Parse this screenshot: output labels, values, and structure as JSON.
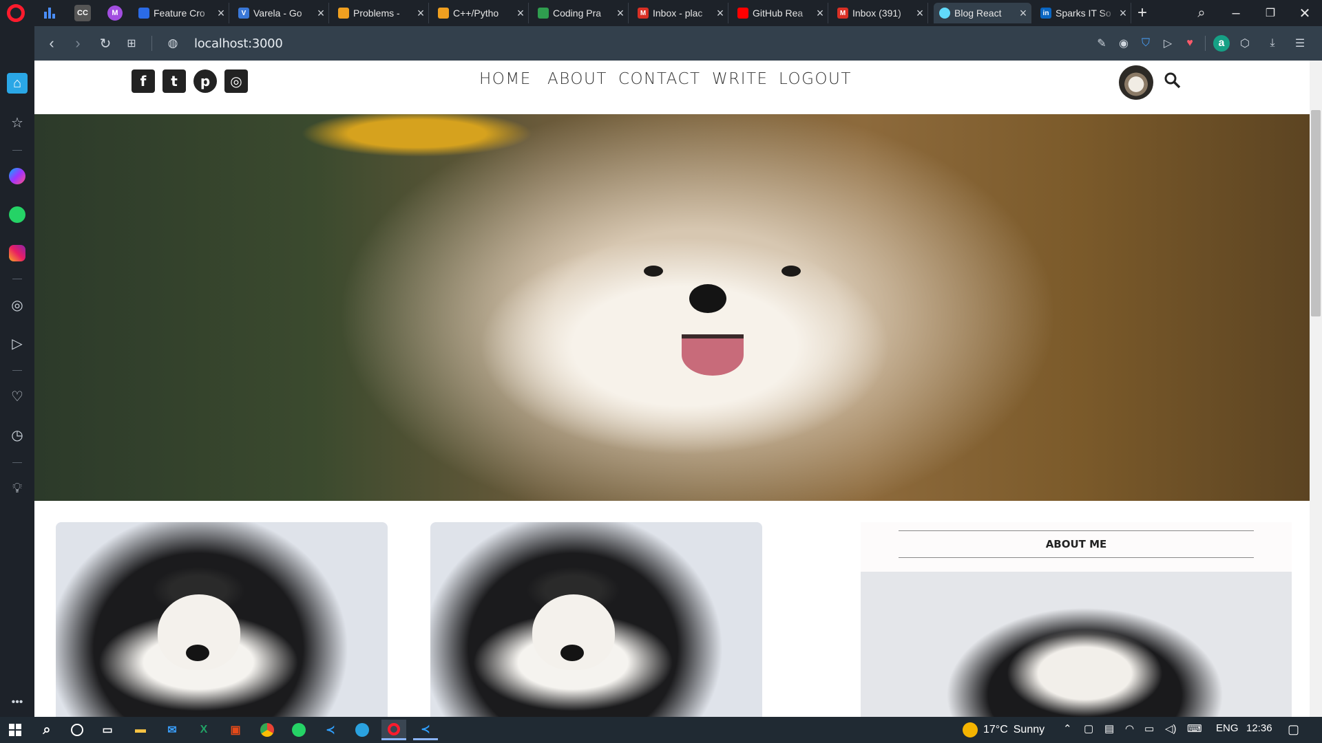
{
  "browser": {
    "tabs": [
      {
        "title": "Feature Cro",
        "favicon_color": "#2b6be6",
        "favicon_text": ""
      },
      {
        "title": "Varela - Go",
        "favicon_color": "#3a78d8",
        "favicon_text": "V"
      },
      {
        "title": "Problems -",
        "favicon_color": "#f0a020",
        "favicon_text": ""
      },
      {
        "title": "C++/Pytho",
        "favicon_color": "#f0a020",
        "favicon_text": ""
      },
      {
        "title": "Coding Pra",
        "favicon_color": "#2f9e4f",
        "favicon_text": ""
      },
      {
        "title": "Inbox - plac",
        "favicon_color": "#d93025",
        "favicon_text": "M"
      },
      {
        "title": "GitHub Rea",
        "favicon_color": "#ff0000",
        "favicon_text": ""
      },
      {
        "title": "Inbox (391)",
        "favicon_color": "#d93025",
        "favicon_text": "M"
      },
      {
        "title": "Blog React",
        "favicon_color": "#61dafb",
        "favicon_text": "",
        "active": true
      },
      {
        "title": "Sparks IT So",
        "favicon_color": "#0a66c2",
        "favicon_text": "in"
      }
    ],
    "url": "localhost:3000",
    "pinned": [
      {
        "name": "charts-pin",
        "text": "",
        "color": "#4a8df6"
      },
      {
        "name": "cc-pin",
        "text": "CC",
        "color": "#555"
      },
      {
        "name": "m-pin",
        "text": "M",
        "color": "#a24ee0"
      }
    ]
  },
  "site": {
    "nav": [
      "HOME",
      "ABOUT",
      "CONTACT",
      "WRITE",
      "LOGOUT"
    ],
    "social": [
      "facebook-icon",
      "twitter-icon",
      "pinterest-icon",
      "instagram-icon"
    ],
    "social_glyphs": [
      "f",
      "t",
      "p",
      "◎"
    ],
    "about_title": "ABOUT ME"
  },
  "taskbar": {
    "weather_temp": "17°C",
    "weather_desc": "Sunny",
    "language": "ENG",
    "time": "12:36"
  }
}
